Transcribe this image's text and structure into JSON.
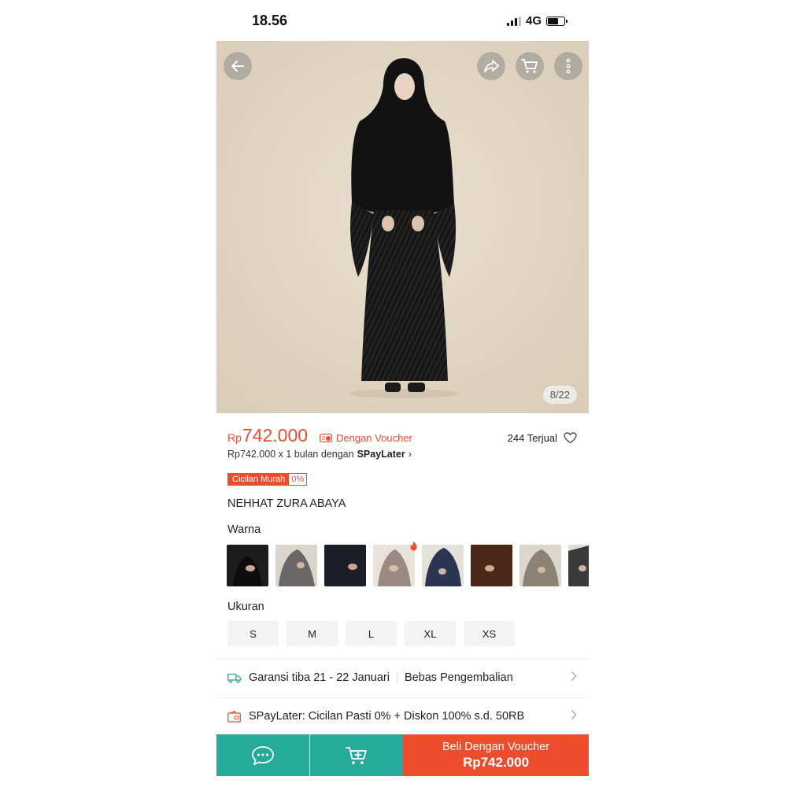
{
  "status_bar": {
    "time": "18.56",
    "network": "4G",
    "battery_level": 0.7
  },
  "product_image": {
    "counter": "8/22"
  },
  "icons": {
    "back": "arrow-left-icon",
    "share": "share-icon",
    "cart": "cart-icon",
    "more": "more-vertical-icon",
    "voucher": "voucher-icon",
    "wishlist": "heart-icon",
    "shipping": "truck-icon",
    "paylater": "wallet-icon",
    "chat": "chat-icon",
    "add_to_cart": "cart-plus-icon"
  },
  "price": {
    "currency": "Rp",
    "amount": "742.000",
    "voucher_label": "Dengan Voucher"
  },
  "sold": "244 Terjual",
  "paylater": {
    "text": "Rp742.000 x 1 bulan dengan",
    "brand": "SPayLater",
    "chevron": "›"
  },
  "badge": {
    "label": "Cicilan Murah",
    "value": "0%"
  },
  "product_title": "NEHHAT ZURA ABAYA",
  "variants": {
    "color_label": "Warna",
    "size_label": "Ukuran",
    "sizes": [
      "S",
      "M",
      "L",
      "XL",
      "XS"
    ]
  },
  "shipping": {
    "text": "Garansi tiba 21 - 22 Januari",
    "returns": "Bebas Pengembalian"
  },
  "promo": {
    "text": "SPayLater: Cicilan Pasti 0% + Diskon 100% s.d. 50RB"
  },
  "bottom_bar": {
    "buy_label": "Beli Dengan Voucher",
    "buy_price": "Rp742.000"
  },
  "colors": {
    "brand": "#ee4d2d",
    "teal": "#26aa99"
  }
}
